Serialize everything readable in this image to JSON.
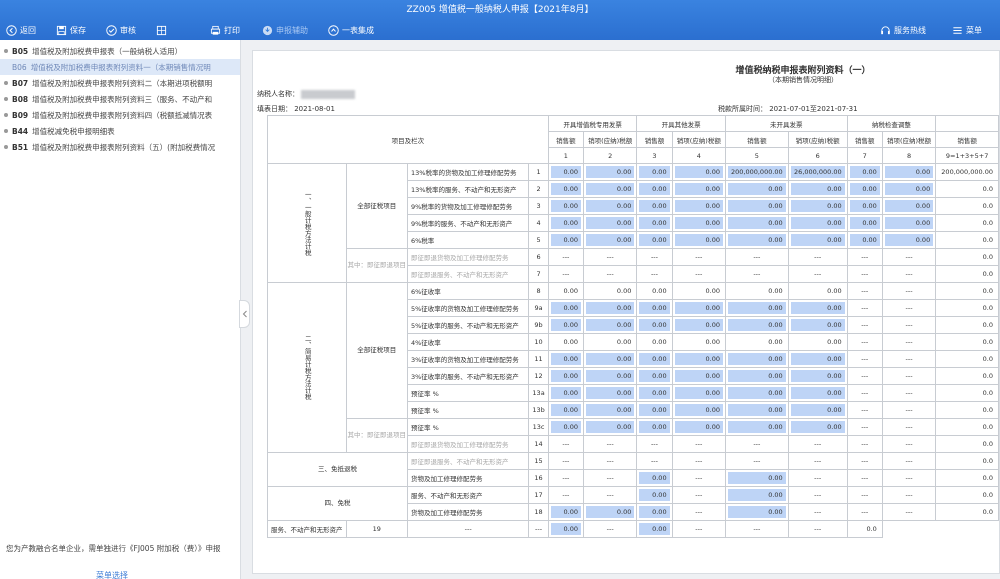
{
  "window": {
    "title": "ZZ005 增值税一般纳税人申报【2021年8月】"
  },
  "toolbar": {
    "back": "返回",
    "save": "保存",
    "check": "审核",
    "print": "打印",
    "fill_assist": "申报辅助",
    "one_table": "一表集成",
    "hotline": "服务热线",
    "menu": "菜单"
  },
  "sidebar": {
    "items": [
      {
        "code": "B05",
        "label": "增值税及附加税费申报表（一般纳税人适用）",
        "active": false,
        "dot": true
      },
      {
        "code": "B06",
        "label": "增值税及附加税费申报表附列资料一（本期销售情况明",
        "active": true,
        "dot": false
      },
      {
        "code": "B07",
        "label": "增值税及附加税费申报表附列资料二（本期进项税额明",
        "active": false,
        "dot": true
      },
      {
        "code": "B08",
        "label": "增值税及附加税费申报表附列资料三（服务、不动产和",
        "active": false,
        "dot": true
      },
      {
        "code": "B09",
        "label": "增值税及附加税费申报表附列资料四（税额抵减情况表",
        "active": false,
        "dot": true
      },
      {
        "code": "B44",
        "label": "增值税减免税申报明细表",
        "active": false,
        "dot": true
      },
      {
        "code": "B51",
        "label": "增值税及附加税费申报表附列资料（五）(附加税费情况",
        "active": false,
        "dot": true
      }
    ],
    "note": "您为产教融合名单企业，需单独进行《FJ005 附加税（费）》申报",
    "bottom_link": "菜单选择"
  },
  "form": {
    "title": "增值税纳税申报表附列资料（一）",
    "subtitle": "（本期销售情况明细）",
    "taxpayer_label": "纳税人名称：",
    "fill_date": "填表日期： 2021-08-01",
    "period": "税款所属时间： 2021-07-01至2021-07-31"
  },
  "table": {
    "project_header": "项目及栏次",
    "groups": [
      "开具增值税专用发票",
      "开具其他发票",
      "未开具发票",
      "纳税检查调整"
    ],
    "sub_headers": [
      "销售额",
      "销项(应纳)税额",
      "销售额",
      "销项(应纳)税额",
      "销售额",
      "销项(应纳)税额",
      "销售额",
      "销项(应纳)税额",
      "销售额"
    ],
    "col_numbers": [
      "1",
      "2",
      "3",
      "4",
      "5",
      "6",
      "7",
      "8",
      "9=1+3+5+7"
    ],
    "sections": [
      {
        "name": "一、一般计税方法计税",
        "rows": 7
      },
      {
        "name": "二、简易计税方法计税",
        "rows": 10
      },
      {
        "name": "三、免抵退税",
        "rows": 2
      },
      {
        "name": "四、免税",
        "rows": 2
      }
    ],
    "subgroups": [
      {
        "name": "全部征税项目",
        "rows": 5
      },
      {
        "name": "其中：即征即退项目",
        "rows": 2
      },
      {
        "name": "全部征税项目",
        "rows": 8
      },
      {
        "name": "其中：即征即退项目",
        "rows": 2
      }
    ],
    "rows": [
      {
        "label": "13%税率的货物及加工修理修配劳务",
        "line": "1",
        "grey": false,
        "cells": [
          [
            "0.00",
            "b"
          ],
          [
            "0.00",
            "b"
          ],
          [
            "0.00",
            "b"
          ],
          [
            "0.00",
            "b"
          ],
          [
            "200,000,000.00",
            "b"
          ],
          [
            "26,000,000.00",
            "b"
          ],
          [
            "0.00",
            "b"
          ],
          [
            "0.00",
            "b"
          ],
          [
            "200,000,000.00",
            "p"
          ]
        ]
      },
      {
        "label": "13%税率的服务、不动产和无形资产",
        "line": "2",
        "grey": false,
        "cells": [
          [
            "0.00",
            "b"
          ],
          [
            "0.00",
            "b"
          ],
          [
            "0.00",
            "b"
          ],
          [
            "0.00",
            "b"
          ],
          [
            "0.00",
            "b"
          ],
          [
            "0.00",
            "b"
          ],
          [
            "0.00",
            "b"
          ],
          [
            "0.00",
            "b"
          ],
          [
            "0.0",
            "p"
          ]
        ]
      },
      {
        "label": "9%税率的货物及加工修理修配劳务",
        "line": "3",
        "grey": false,
        "cells": [
          [
            "0.00",
            "b"
          ],
          [
            "0.00",
            "b"
          ],
          [
            "0.00",
            "b"
          ],
          [
            "0.00",
            "b"
          ],
          [
            "0.00",
            "b"
          ],
          [
            "0.00",
            "b"
          ],
          [
            "0.00",
            "b"
          ],
          [
            "0.00",
            "b"
          ],
          [
            "0.0",
            "p"
          ]
        ]
      },
      {
        "label": "9%税率的服务、不动产和无形资产",
        "line": "4",
        "grey": false,
        "cells": [
          [
            "0.00",
            "b"
          ],
          [
            "0.00",
            "b"
          ],
          [
            "0.00",
            "b"
          ],
          [
            "0.00",
            "b"
          ],
          [
            "0.00",
            "b"
          ],
          [
            "0.00",
            "b"
          ],
          [
            "0.00",
            "b"
          ],
          [
            "0.00",
            "b"
          ],
          [
            "0.0",
            "p"
          ]
        ]
      },
      {
        "label": "6%税率",
        "line": "5",
        "grey": false,
        "cells": [
          [
            "0.00",
            "b"
          ],
          [
            "0.00",
            "b"
          ],
          [
            "0.00",
            "b"
          ],
          [
            "0.00",
            "b"
          ],
          [
            "0.00",
            "b"
          ],
          [
            "0.00",
            "b"
          ],
          [
            "0.00",
            "b"
          ],
          [
            "0.00",
            "b"
          ],
          [
            "0.0",
            "p"
          ]
        ]
      },
      {
        "label": "即征即退货物及加工修理修配劳务",
        "line": "6",
        "grey": true,
        "cells": [
          [
            "---",
            "d"
          ],
          [
            "---",
            "d"
          ],
          [
            "---",
            "d"
          ],
          [
            "---",
            "d"
          ],
          [
            "---",
            "d"
          ],
          [
            "---",
            "d"
          ],
          [
            "---",
            "d"
          ],
          [
            "---",
            "d"
          ],
          [
            "0.0",
            "p"
          ]
        ]
      },
      {
        "label": "即征即退服务、不动产和无形资产",
        "line": "7",
        "grey": true,
        "cells": [
          [
            "---",
            "d"
          ],
          [
            "---",
            "d"
          ],
          [
            "---",
            "d"
          ],
          [
            "---",
            "d"
          ],
          [
            "---",
            "d"
          ],
          [
            "---",
            "d"
          ],
          [
            "---",
            "d"
          ],
          [
            "---",
            "d"
          ],
          [
            "0.0",
            "p"
          ]
        ]
      },
      {
        "label": "6%征收率",
        "line": "8",
        "grey": false,
        "cells": [
          [
            "0.00",
            "p"
          ],
          [
            "0.00",
            "p"
          ],
          [
            "0.00",
            "p"
          ],
          [
            "0.00",
            "p"
          ],
          [
            "0.00",
            "p"
          ],
          [
            "0.00",
            "p"
          ],
          [
            "---",
            "d"
          ],
          [
            "---",
            "d"
          ],
          [
            "0.0",
            "p"
          ]
        ]
      },
      {
        "label": "5%征收率的货物及加工修理修配劳务",
        "line": "9a",
        "grey": false,
        "cells": [
          [
            "0.00",
            "b"
          ],
          [
            "0.00",
            "b"
          ],
          [
            "0.00",
            "b"
          ],
          [
            "0.00",
            "b"
          ],
          [
            "0.00",
            "b"
          ],
          [
            "0.00",
            "b"
          ],
          [
            "---",
            "d"
          ],
          [
            "---",
            "d"
          ],
          [
            "0.0",
            "p"
          ]
        ]
      },
      {
        "label": "5%征收率的服务、不动产和无形资产",
        "line": "9b",
        "grey": false,
        "cells": [
          [
            "0.00",
            "b"
          ],
          [
            "0.00",
            "b"
          ],
          [
            "0.00",
            "b"
          ],
          [
            "0.00",
            "b"
          ],
          [
            "0.00",
            "b"
          ],
          [
            "0.00",
            "b"
          ],
          [
            "---",
            "d"
          ],
          [
            "---",
            "d"
          ],
          [
            "0.0",
            "p"
          ]
        ]
      },
      {
        "label": "4%征收率",
        "line": "10",
        "grey": false,
        "cells": [
          [
            "0.00",
            "p"
          ],
          [
            "0.00",
            "p"
          ],
          [
            "0.00",
            "p"
          ],
          [
            "0.00",
            "p"
          ],
          [
            "0.00",
            "p"
          ],
          [
            "0.00",
            "p"
          ],
          [
            "---",
            "d"
          ],
          [
            "---",
            "d"
          ],
          [
            "0.0",
            "p"
          ]
        ]
      },
      {
        "label": "3%征收率的货物及加工修理修配劳务",
        "line": "11",
        "grey": false,
        "cells": [
          [
            "0.00",
            "b"
          ],
          [
            "0.00",
            "b"
          ],
          [
            "0.00",
            "b"
          ],
          [
            "0.00",
            "b"
          ],
          [
            "0.00",
            "b"
          ],
          [
            "0.00",
            "b"
          ],
          [
            "---",
            "d"
          ],
          [
            "---",
            "d"
          ],
          [
            "0.0",
            "p"
          ]
        ]
      },
      {
        "label": "3%征收率的服务、不动产和无形资产",
        "line": "12",
        "grey": false,
        "cells": [
          [
            "0.00",
            "b"
          ],
          [
            "0.00",
            "b"
          ],
          [
            "0.00",
            "b"
          ],
          [
            "0.00",
            "b"
          ],
          [
            "0.00",
            "b"
          ],
          [
            "0.00",
            "b"
          ],
          [
            "---",
            "d"
          ],
          [
            "---",
            "d"
          ],
          [
            "0.0",
            "p"
          ]
        ]
      },
      {
        "label": "预征率      %",
        "line": "13a",
        "grey": false,
        "cells": [
          [
            "0.00",
            "b"
          ],
          [
            "0.00",
            "b"
          ],
          [
            "0.00",
            "b"
          ],
          [
            "0.00",
            "b"
          ],
          [
            "0.00",
            "b"
          ],
          [
            "0.00",
            "b"
          ],
          [
            "---",
            "d"
          ],
          [
            "---",
            "d"
          ],
          [
            "0.0",
            "p"
          ]
        ]
      },
      {
        "label": "预征率      %",
        "line": "13b",
        "grey": false,
        "cells": [
          [
            "0.00",
            "b"
          ],
          [
            "0.00",
            "b"
          ],
          [
            "0.00",
            "b"
          ],
          [
            "0.00",
            "b"
          ],
          [
            "0.00",
            "b"
          ],
          [
            "0.00",
            "b"
          ],
          [
            "---",
            "d"
          ],
          [
            "---",
            "d"
          ],
          [
            "0.0",
            "p"
          ]
        ]
      },
      {
        "label": "预征率      %",
        "line": "13c",
        "grey": false,
        "cells": [
          [
            "0.00",
            "b"
          ],
          [
            "0.00",
            "b"
          ],
          [
            "0.00",
            "b"
          ],
          [
            "0.00",
            "b"
          ],
          [
            "0.00",
            "b"
          ],
          [
            "0.00",
            "b"
          ],
          [
            "---",
            "d"
          ],
          [
            "---",
            "d"
          ],
          [
            "0.0",
            "p"
          ]
        ]
      },
      {
        "label": "即征即退货物及加工修理修配劳务",
        "line": "14",
        "grey": true,
        "cells": [
          [
            "---",
            "d"
          ],
          [
            "---",
            "d"
          ],
          [
            "---",
            "d"
          ],
          [
            "---",
            "d"
          ],
          [
            "---",
            "d"
          ],
          [
            "---",
            "d"
          ],
          [
            "---",
            "d"
          ],
          [
            "---",
            "d"
          ],
          [
            "0.0",
            "p"
          ]
        ]
      },
      {
        "label": "即征即退服务、不动产和无形资产",
        "line": "15",
        "grey": true,
        "cells": [
          [
            "---",
            "d"
          ],
          [
            "---",
            "d"
          ],
          [
            "---",
            "d"
          ],
          [
            "---",
            "d"
          ],
          [
            "---",
            "d"
          ],
          [
            "---",
            "d"
          ],
          [
            "---",
            "d"
          ],
          [
            "---",
            "d"
          ],
          [
            "0.0",
            "p"
          ]
        ]
      },
      {
        "label": "货物及加工修理修配劳务",
        "line": "16",
        "grey": false,
        "cells": [
          [
            "---",
            "d"
          ],
          [
            "---",
            "d"
          ],
          [
            "0.00",
            "b"
          ],
          [
            "---",
            "d"
          ],
          [
            "0.00",
            "b"
          ],
          [
            "---",
            "d"
          ],
          [
            "---",
            "d"
          ],
          [
            "---",
            "d"
          ],
          [
            "0.0",
            "p"
          ]
        ]
      },
      {
        "label": "服务、不动产和无形资产",
        "line": "17",
        "grey": false,
        "cells": [
          [
            "---",
            "d"
          ],
          [
            "---",
            "d"
          ],
          [
            "0.00",
            "b"
          ],
          [
            "---",
            "d"
          ],
          [
            "0.00",
            "b"
          ],
          [
            "---",
            "d"
          ],
          [
            "---",
            "d"
          ],
          [
            "---",
            "d"
          ],
          [
            "0.0",
            "p"
          ]
        ]
      },
      {
        "label": "货物及加工修理修配劳务",
        "line": "18",
        "grey": false,
        "cells": [
          [
            "0.00",
            "b"
          ],
          [
            "0.00",
            "b"
          ],
          [
            "0.00",
            "b"
          ],
          [
            "---",
            "d"
          ],
          [
            "0.00",
            "b"
          ],
          [
            "---",
            "d"
          ],
          [
            "---",
            "d"
          ],
          [
            "---",
            "d"
          ],
          [
            "0.0",
            "p"
          ]
        ]
      },
      {
        "label": "服务、不动产和无形资产",
        "line": "19",
        "grey": false,
        "cells": [
          [
            "---",
            "d"
          ],
          [
            "---",
            "d"
          ],
          [
            "0.00",
            "b"
          ],
          [
            "---",
            "d"
          ],
          [
            "0.00",
            "b"
          ],
          [
            "---",
            "d"
          ],
          [
            "---",
            "d"
          ],
          [
            "---",
            "d"
          ],
          [
            "0.0",
            "p"
          ]
        ]
      }
    ]
  },
  "icons": {
    "back": "back-arrow-icon",
    "save": "save-disk-icon",
    "check": "check-circle-icon",
    "print": "printer-icon",
    "fill_assist": "assist-icon",
    "one_table": "up-circle-icon",
    "hotline": "headset-icon",
    "menu": "hamburger-icon"
  },
  "colors": {
    "topbar": "#2f77d8",
    "input_cell": "#bed4f6",
    "sidebar_active": "#dde8f8"
  }
}
